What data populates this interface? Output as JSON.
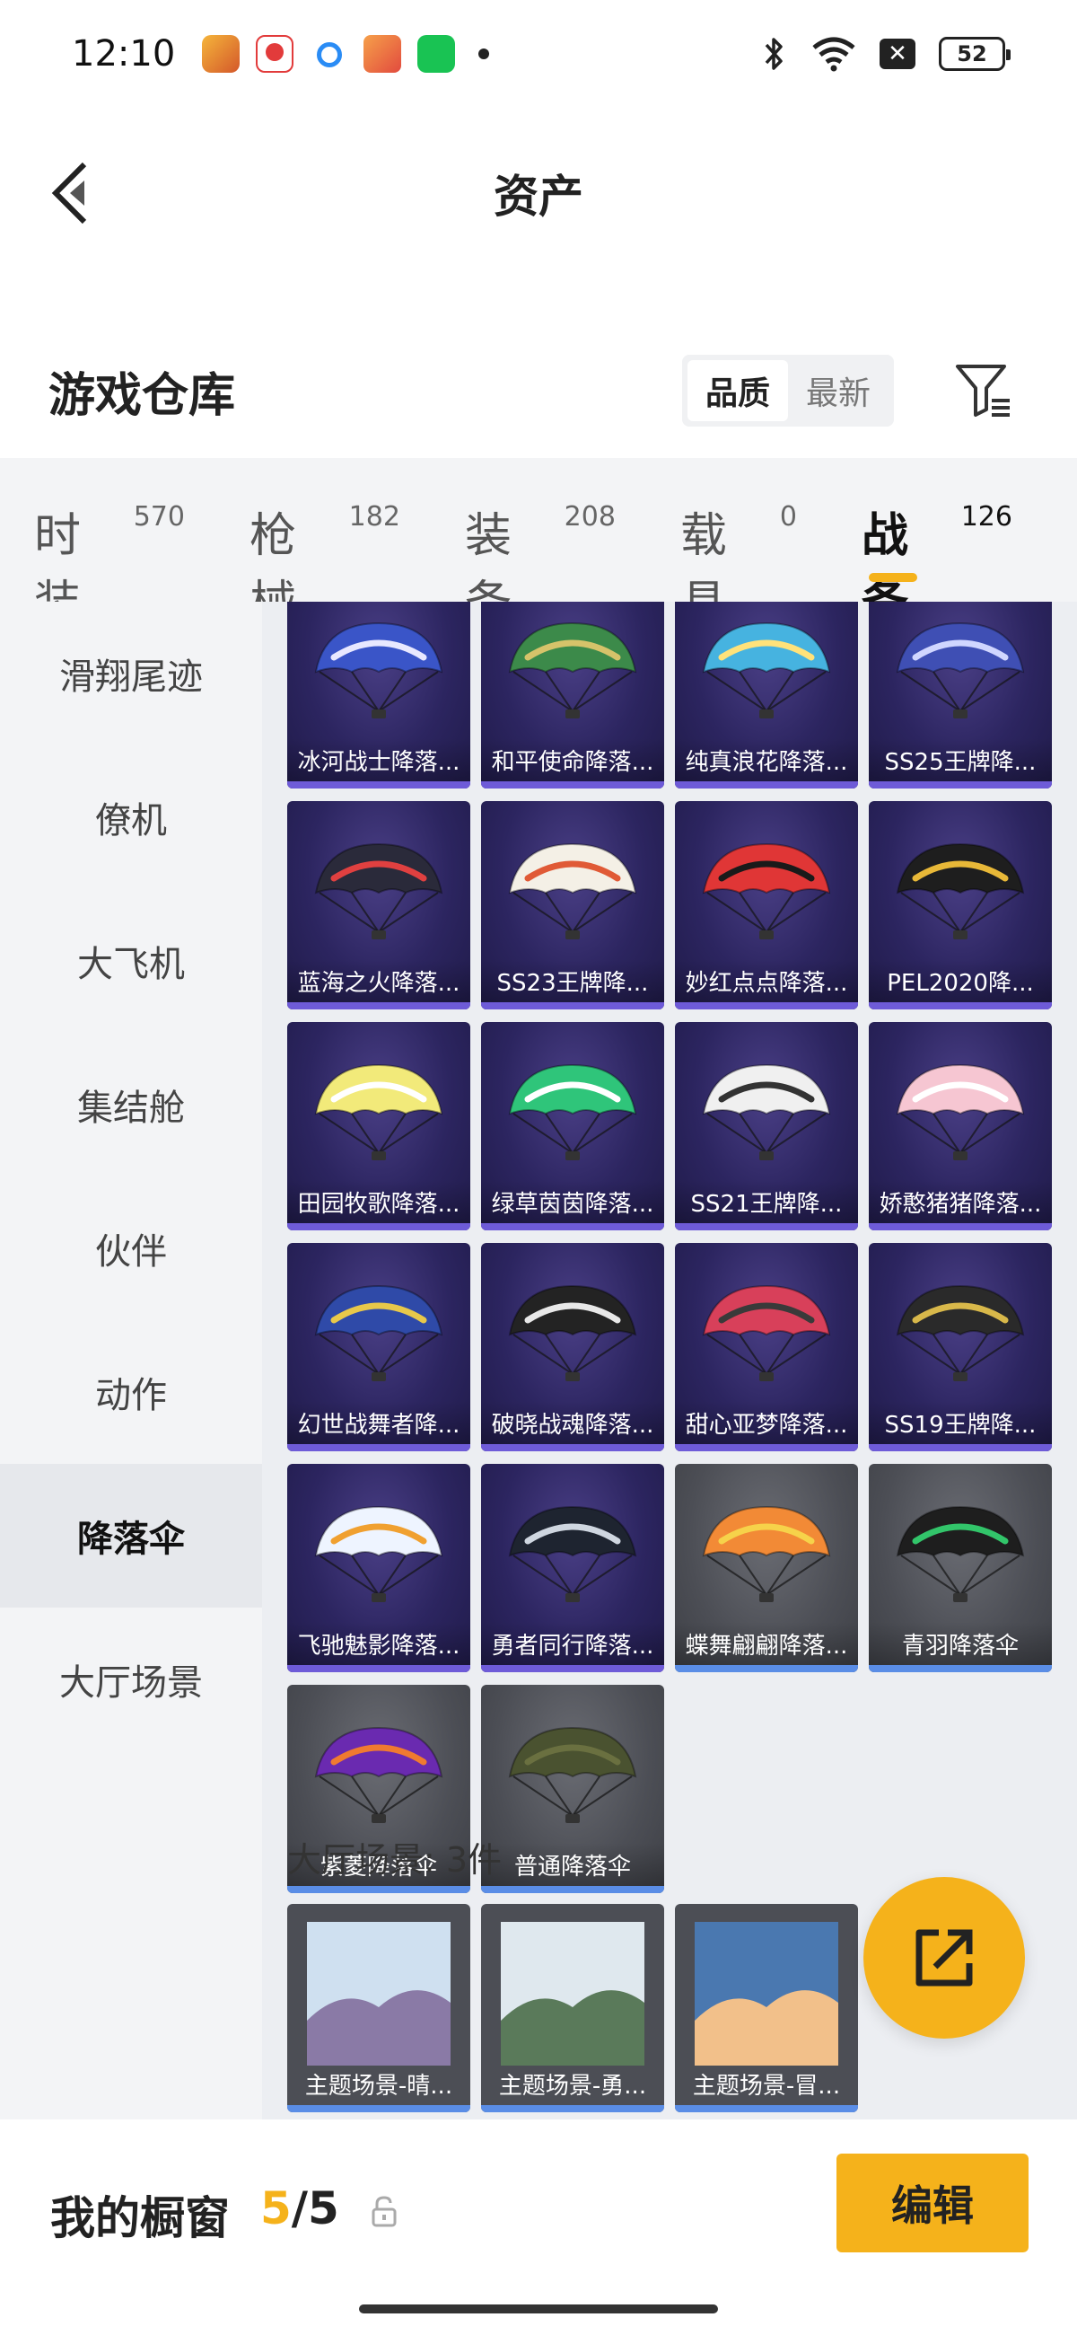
{
  "status_bar": {
    "time": "12:10",
    "battery": "52",
    "icons": [
      "app-icon-1",
      "app-icon-2",
      "app-icon-3",
      "app-icon-4",
      "app-icon-5",
      "bluetooth-icon",
      "wifi-icon",
      "close-box-icon",
      "battery-icon"
    ]
  },
  "header": {
    "title": "资产",
    "back_icon": "chevron-left-icon"
  },
  "warehouse": {
    "title": "游戏仓库",
    "sort_options": [
      "品质",
      "最新"
    ],
    "sort_active": "品质",
    "filter_icon": "filter-icon"
  },
  "category_tabs": [
    {
      "label": "时装",
      "count": "570"
    },
    {
      "label": "枪械",
      "count": "182"
    },
    {
      "label": "装备",
      "count": "208"
    },
    {
      "label": "载具",
      "count": "0"
    },
    {
      "label": "战备",
      "count": "126",
      "active": true
    }
  ],
  "sidebar": [
    {
      "label": "滑翔尾迹"
    },
    {
      "label": "僚机"
    },
    {
      "label": "大飞机"
    },
    {
      "label": "集结舱"
    },
    {
      "label": "伙伴"
    },
    {
      "label": "动作"
    },
    {
      "label": "降落伞",
      "active": true
    },
    {
      "label": "大厅场景"
    }
  ],
  "parachutes": [
    {
      "name": "冰河战士降落...",
      "color": "#3a55c8",
      "accent": "#e8e8ff"
    },
    {
      "name": "和平使命降落...",
      "color": "#3c8a4a",
      "accent": "#d6c36a"
    },
    {
      "name": "纯真浪花降落...",
      "color": "#46b3e0",
      "accent": "#ffe27a"
    },
    {
      "name": "SS25王牌降...",
      "color": "#3f4fb4",
      "accent": "#d0d6ff"
    },
    {
      "name": "蓝海之火降落...",
      "color": "#2a2a3a",
      "accent": "#e04040"
    },
    {
      "name": "SS23王牌降...",
      "color": "#f4f0e6",
      "accent": "#e05a36"
    },
    {
      "name": "妙红点点降落...",
      "color": "#e03636",
      "accent": "#1a1a1a"
    },
    {
      "name": "PEL2020降...",
      "color": "#1e1e1e",
      "accent": "#e8b838"
    },
    {
      "name": "田园牧歌降落...",
      "color": "#f2ea7a",
      "accent": "#ffffff"
    },
    {
      "name": "绿草茵茵降落...",
      "color": "#2fc57a",
      "accent": "#ffffff"
    },
    {
      "name": "SS21王牌降...",
      "color": "#f0f0f0",
      "accent": "#333333"
    },
    {
      "name": "娇憨猪猪降落...",
      "color": "#f6c6d2",
      "accent": "#ffffff"
    },
    {
      "name": "幻世战舞者降...",
      "color": "#2f4aa8",
      "accent": "#e8c84a"
    },
    {
      "name": "破晓战魂降落...",
      "color": "#232323",
      "accent": "#e8e8e8"
    },
    {
      "name": "甜心亚梦降落...",
      "color": "#d8405a",
      "accent": "#3a3a3a"
    },
    {
      "name": "SS19王牌降...",
      "color": "#2a2a2a",
      "accent": "#d8b84a"
    },
    {
      "name": "飞驰魅影降落...",
      "color": "#eef4ff",
      "accent": "#f0a030"
    },
    {
      "name": "勇者同行降落...",
      "color": "#1e2430",
      "accent": "#cfd6e0"
    },
    {
      "name": "蝶舞翩翩降落...",
      "color": "#f28a36",
      "accent": "#f6d24a",
      "gray": true
    },
    {
      "name": "青羽降落伞",
      "color": "#1e1e1e",
      "accent": "#32c56a",
      "gray": true
    },
    {
      "name": "紫菱降落伞",
      "color": "#6a2ab0",
      "accent": "#f07a30",
      "gray": true
    },
    {
      "name": "普通降落伞",
      "color": "#4a5230",
      "accent": "#6a7040",
      "gray": true
    }
  ],
  "scenes": {
    "label": "大厅场景: 3件",
    "items": [
      {
        "name": "主题场景-晴...",
        "sky": "#cfe0f0",
        "ground": "#8a7aa6"
      },
      {
        "name": "主题场景-勇...",
        "sky": "#dfe8ee",
        "ground": "#5a7a5a"
      },
      {
        "name": "主题场景-冒...",
        "sky": "#4a78b0",
        "ground": "#f2c08a"
      }
    ]
  },
  "share_icon": "share-icon",
  "bottom": {
    "window_label": "我的橱窗",
    "window_current": "5",
    "window_sep_total": "/5",
    "lock_icon": "unlock-icon",
    "edit_label": "编辑"
  },
  "colors": {
    "accent": "#f5b21b",
    "card_purple": "#2c2560",
    "card_gray": "#4c4e55",
    "bar_purple": "#6e5bd8",
    "bar_blue": "#5a8de6"
  }
}
